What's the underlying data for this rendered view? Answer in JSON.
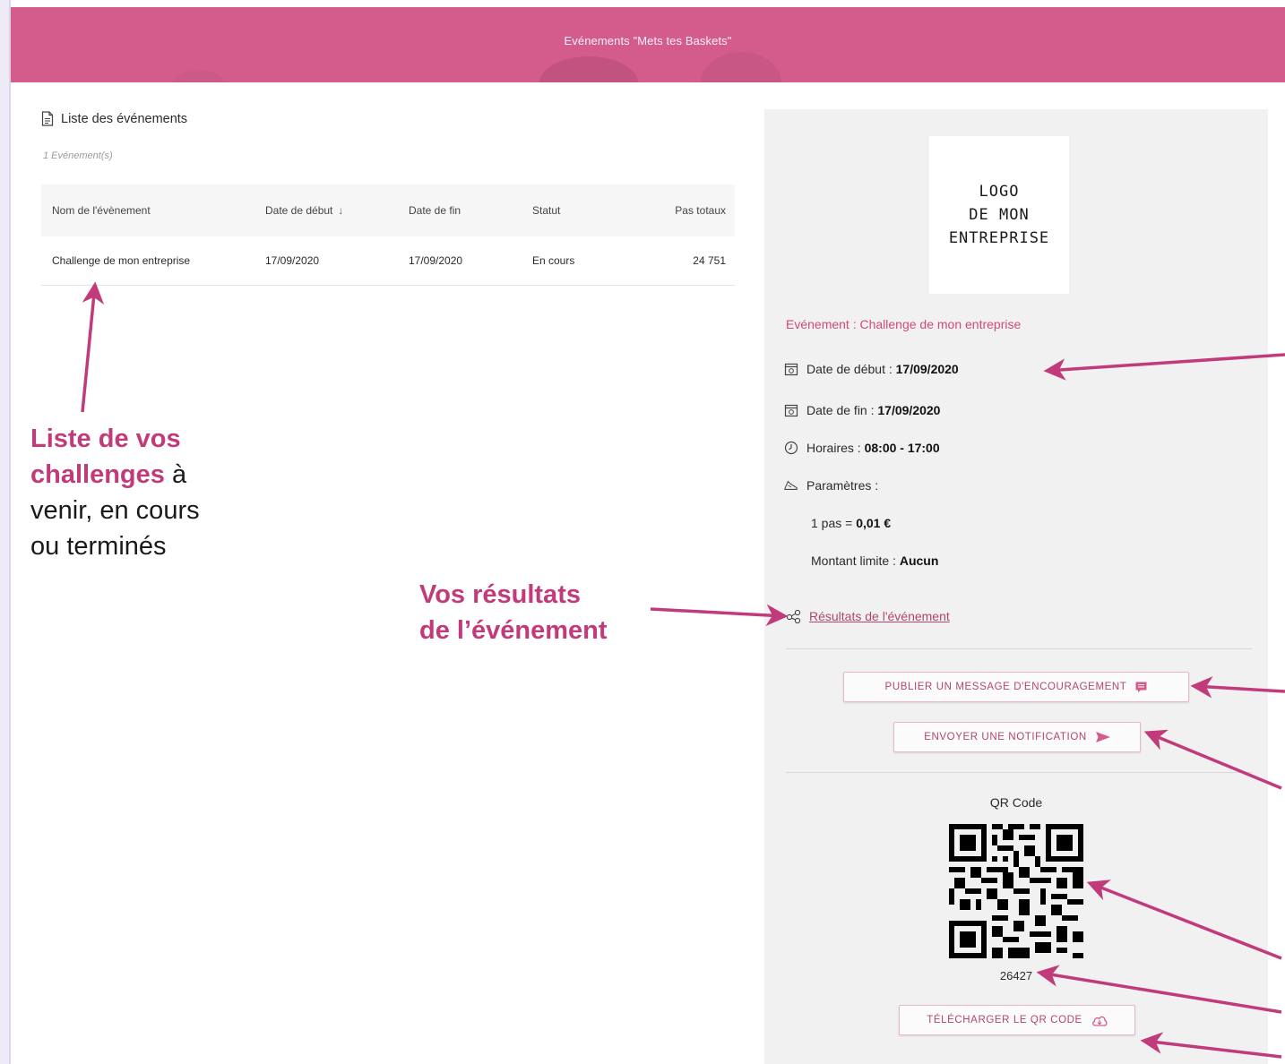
{
  "header": {
    "title": "Evénements \"Mets tes Baskets\""
  },
  "list": {
    "title": "Liste des événements",
    "count": "1 Evénement(s)",
    "columns": [
      "Nom de l'évènement",
      "Date de début",
      "Date de fin",
      "Statut",
      "Pas totaux"
    ],
    "sort_arrow": "↓",
    "rows": [
      {
        "name": "Challenge de mon entreprise",
        "start": "17/09/2020",
        "end": "17/09/2020",
        "status": "En cours",
        "steps": "24 751"
      }
    ]
  },
  "detail": {
    "logo_lines": [
      "LOGO",
      "DE MON",
      "ENTREPRISE"
    ],
    "event_label": "Evénement : Challenge de mon entreprise",
    "start_label": "Date de début : ",
    "start_value": "17/09/2020",
    "end_label": "Date de fin : ",
    "end_value": "17/09/2020",
    "hours_label": "Horaires : ",
    "hours_value": "08:00 - 17:00",
    "params_label": "Paramètres :",
    "step_label": "1 pas = ",
    "step_value": "0,01 €",
    "limit_label": "Montant limite : ",
    "limit_value": "Aucun",
    "results_link": "Résultats de l'événement",
    "publish_button": "PUBLIER UN MESSAGE D'ENCOURAGEMENT",
    "notify_button": "ENVOYER UNE NOTIFICATION",
    "qr_label": "QR Code",
    "qr_number": "26427",
    "download_button": "TÉLÉCHARGER LE QR CODE"
  },
  "annotations": {
    "list_hl1": "Liste de vos",
    "list_hl2": "challenges",
    "list_rest1": " à",
    "list_rest2": "venir, en cours",
    "list_rest3": "ou terminés",
    "results_line1": "Vos résultats",
    "results_line2": "de l’événement"
  },
  "colors": {
    "accent": "#d35c8c",
    "link": "#b4456f",
    "annotation": "#c13b7b",
    "status_in_progress": "#f1b45a"
  }
}
